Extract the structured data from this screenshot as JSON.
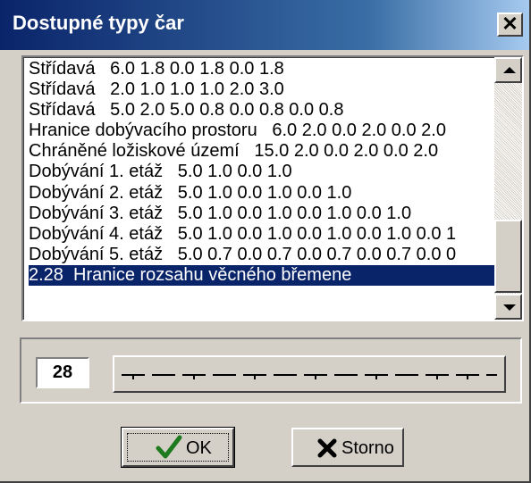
{
  "dialog": {
    "title": "Dostupné typy čar",
    "close_glyph": "✕"
  },
  "list": {
    "items": [
      "Střídavá   6.0 1.8 0.0 1.8 0.0 1.8",
      "Střídavá   2.0 1.0 1.0 1.0 2.0 3.0",
      "Střídavá   5.0 2.0 5.0 0.8 0.0 0.8 0.0 0.8",
      "Hranice dobývacího prostoru   6.0 2.0 0.0 2.0 0.0 2.0",
      "Chráněné ložiskové území   15.0 2.0 0.0 2.0 0.0 2.0",
      "Dobývání 1. etáž   5.0 1.0 0.0 1.0",
      "Dobývání 2. etáž   5.0 1.0 0.0 1.0 0.0 1.0",
      "Dobývání 3. etáž   5.0 1.0 0.0 1.0 0.0 1.0 0.0 1.0",
      "Dobývání 4. etáž   5.0 1.0 0.0 1.0 0.0 1.0 0.0 1.0 0.0 1",
      "Dobývání 5. etáž   5.0 0.7 0.0 0.7 0.0 0.7 0.0 0.7 0.0 0",
      "2.28  Hranice rozsahu věcného břemene"
    ],
    "selected_index": 10
  },
  "preview": {
    "number": "28"
  },
  "buttons": {
    "ok_label": "OK",
    "storno_label": "Storno"
  },
  "icons": {
    "ok": "checkmark-icon",
    "storno": "x-icon"
  },
  "colors": {
    "selection": "#0a246a",
    "check": "#1e7a1e",
    "cross": "#000000"
  }
}
